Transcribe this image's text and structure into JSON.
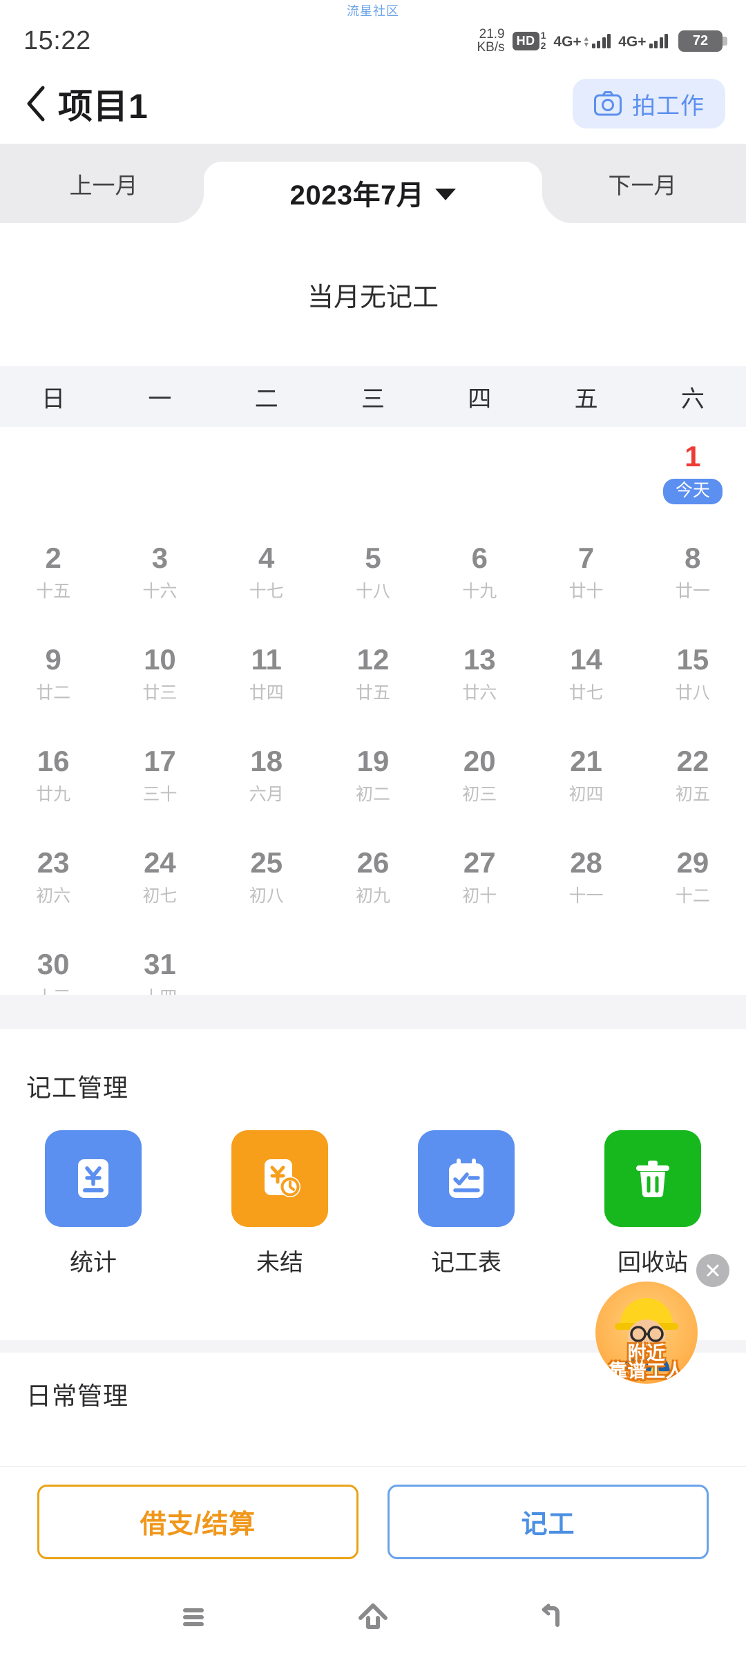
{
  "watermark": "流星社区",
  "statusbar": {
    "time": "15:22",
    "net_speed_value": "21.9",
    "net_speed_unit": "KB/s",
    "hd_label": "HD",
    "sim1": "1",
    "sim2": "2",
    "signal1_label": "4G+",
    "signal2_label": "4G+",
    "battery_level": "72"
  },
  "appbar": {
    "back_icon": "chevron-left-icon",
    "title": "项目1",
    "camera_icon": "camera-icon",
    "camera_label": "拍工作"
  },
  "monthbar": {
    "prev_label": "上一月",
    "current_label": "2023年7月",
    "caret_icon": "caret-down-icon",
    "next_label": "下一月"
  },
  "status_text": "当月无记工",
  "calendar": {
    "weekdays": [
      "日",
      "一",
      "二",
      "三",
      "四",
      "五",
      "六"
    ],
    "today_badge": "今天",
    "rows": [
      [
        {
          "day": "",
          "lunar": ""
        },
        {
          "day": "",
          "lunar": ""
        },
        {
          "day": "",
          "lunar": ""
        },
        {
          "day": "",
          "lunar": ""
        },
        {
          "day": "",
          "lunar": ""
        },
        {
          "day": "",
          "lunar": ""
        },
        {
          "day": "1",
          "lunar": "",
          "today": true
        }
      ],
      [
        {
          "day": "2",
          "lunar": "十五"
        },
        {
          "day": "3",
          "lunar": "十六"
        },
        {
          "day": "4",
          "lunar": "十七"
        },
        {
          "day": "5",
          "lunar": "十八"
        },
        {
          "day": "6",
          "lunar": "十九"
        },
        {
          "day": "7",
          "lunar": "廿十"
        },
        {
          "day": "8",
          "lunar": "廿一"
        }
      ],
      [
        {
          "day": "9",
          "lunar": "廿二"
        },
        {
          "day": "10",
          "lunar": "廿三"
        },
        {
          "day": "11",
          "lunar": "廿四"
        },
        {
          "day": "12",
          "lunar": "廿五"
        },
        {
          "day": "13",
          "lunar": "廿六"
        },
        {
          "day": "14",
          "lunar": "廿七"
        },
        {
          "day": "15",
          "lunar": "廿八"
        }
      ],
      [
        {
          "day": "16",
          "lunar": "廿九"
        },
        {
          "day": "17",
          "lunar": "三十"
        },
        {
          "day": "18",
          "lunar": "六月"
        },
        {
          "day": "19",
          "lunar": "初二"
        },
        {
          "day": "20",
          "lunar": "初三"
        },
        {
          "day": "21",
          "lunar": "初四"
        },
        {
          "day": "22",
          "lunar": "初五"
        }
      ],
      [
        {
          "day": "23",
          "lunar": "初六"
        },
        {
          "day": "24",
          "lunar": "初七"
        },
        {
          "day": "25",
          "lunar": "初八"
        },
        {
          "day": "26",
          "lunar": "初九"
        },
        {
          "day": "27",
          "lunar": "初十"
        },
        {
          "day": "28",
          "lunar": "十一"
        },
        {
          "day": "29",
          "lunar": "十二"
        }
      ],
      [
        {
          "day": "30",
          "lunar": "十三"
        },
        {
          "day": "31",
          "lunar": "十四"
        },
        {
          "day": "",
          "lunar": ""
        },
        {
          "day": "",
          "lunar": ""
        },
        {
          "day": "",
          "lunar": ""
        },
        {
          "day": "",
          "lunar": ""
        },
        {
          "day": "",
          "lunar": ""
        }
      ]
    ]
  },
  "work_section": {
    "title": "记工管理",
    "tiles": [
      {
        "label": "统计",
        "icon": "yuan-document-icon",
        "color": "#5b8ff0"
      },
      {
        "label": "未结",
        "icon": "yuan-document-clock-icon",
        "color": "#f79e1b"
      },
      {
        "label": "记工表",
        "icon": "clipboard-check-icon",
        "color": "#5b8ff0"
      },
      {
        "label": "回收站",
        "icon": "trash-icon",
        "color": "#16b81e"
      }
    ]
  },
  "daily_section": {
    "title": "日常管理"
  },
  "actions": {
    "loan_label": "借支/结算",
    "loan_color": "#f0971a",
    "record_label": "记工",
    "record_color": "#4b8fe3"
  },
  "ad": {
    "line1": "附近",
    "line2": "靠谱工人",
    "close_icon": "close-icon"
  },
  "navbar": {
    "recents_icon": "menu-icon",
    "home_icon": "home-icon",
    "back_icon": "back-arrow-icon"
  }
}
